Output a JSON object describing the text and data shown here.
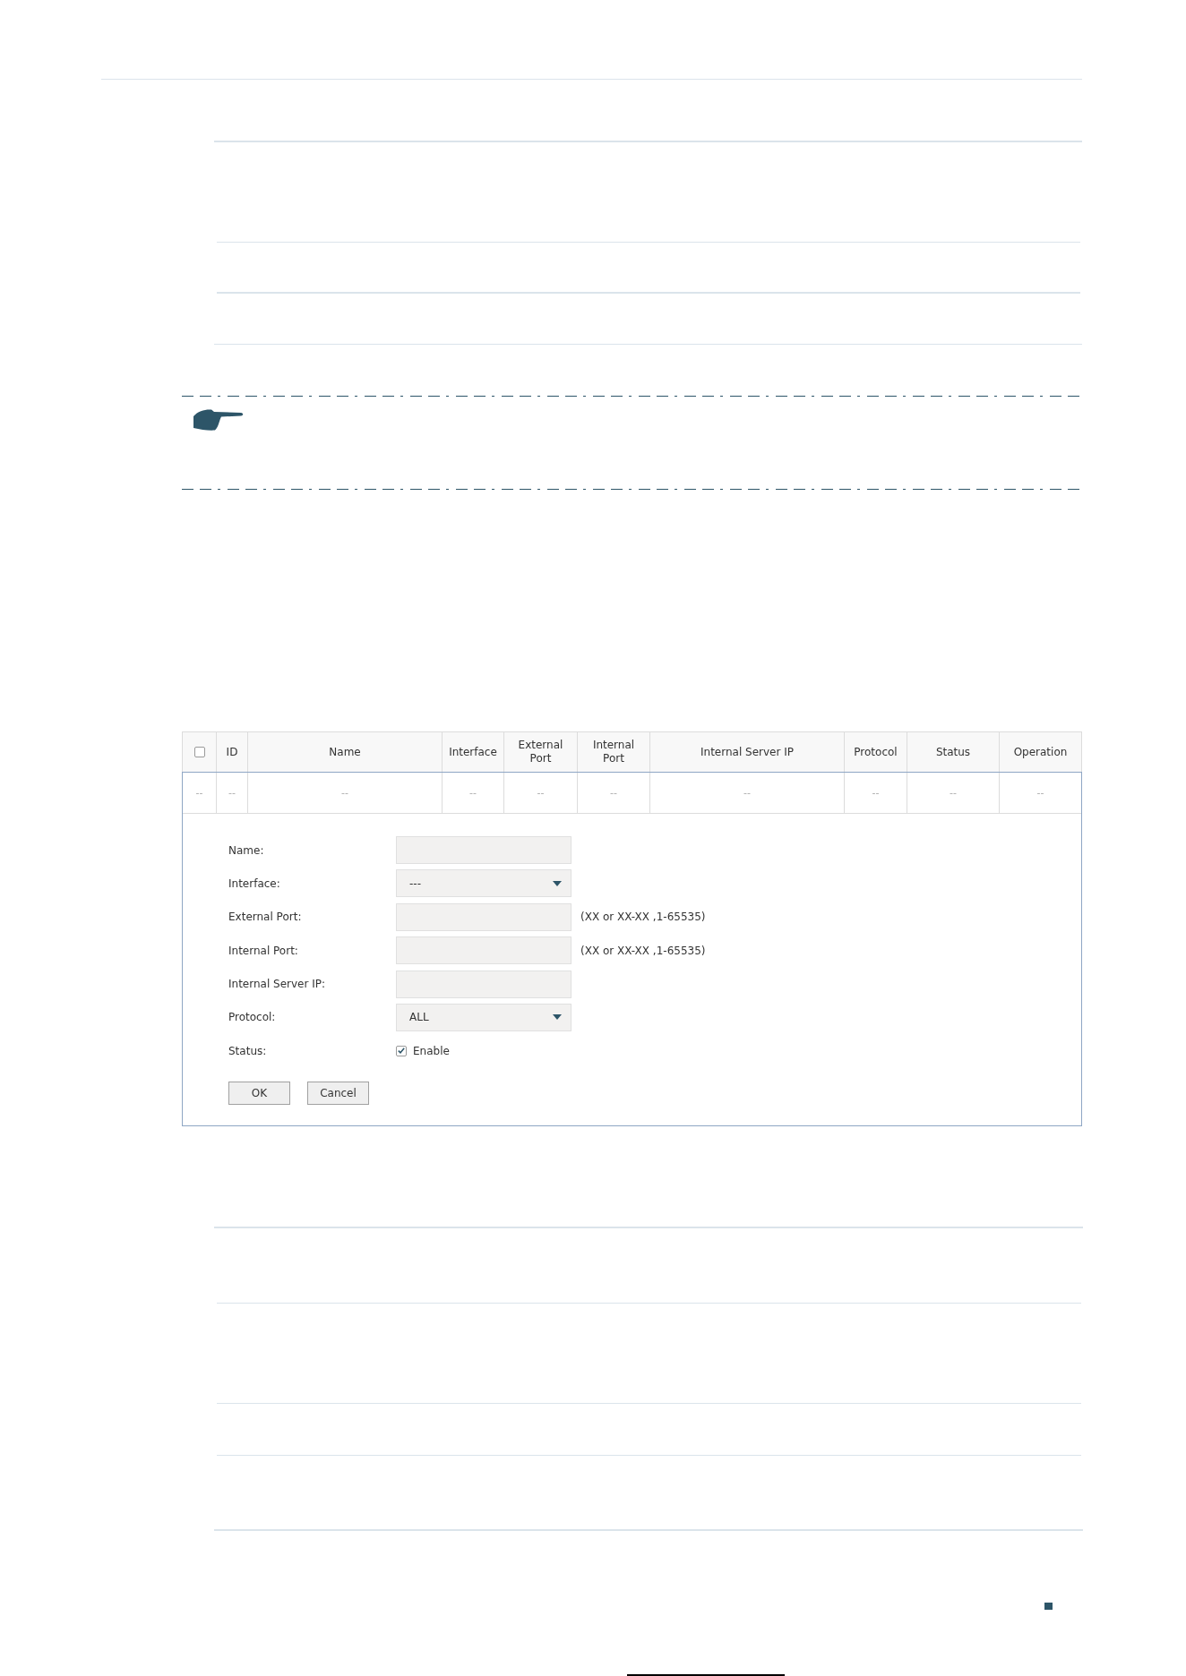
{
  "table": {
    "columns": [
      {
        "kind": "checkbox",
        "checked": false
      },
      {
        "kind": "text",
        "label": "ID"
      },
      {
        "kind": "text",
        "label": "Name"
      },
      {
        "kind": "text",
        "label": "Interface"
      },
      {
        "kind": "text",
        "label": "External Port"
      },
      {
        "kind": "text",
        "label": "Internal Port"
      },
      {
        "kind": "text",
        "label": "Internal Server IP"
      },
      {
        "kind": "text",
        "label": "Protocol"
      },
      {
        "kind": "text",
        "label": "Status"
      },
      {
        "kind": "text",
        "label": "Operation"
      }
    ],
    "rows": [
      {
        "cells": [
          "--",
          "--",
          "--",
          "--",
          "--",
          "--",
          "--",
          "--",
          "--",
          "--"
        ]
      }
    ]
  },
  "form": {
    "fields": [
      {
        "kind": "input",
        "label": "Name:"
      },
      {
        "kind": "select",
        "label": "Interface:",
        "value": "---"
      },
      {
        "kind": "input",
        "label": "External Port:",
        "hint": "(XX or XX-XX ,1-65535)"
      },
      {
        "kind": "input",
        "label": "Internal Port:",
        "hint": "(XX or XX-XX ,1-65535)"
      },
      {
        "kind": "input",
        "label": "Internal Server IP:"
      },
      {
        "kind": "select",
        "label": "Protocol:",
        "value": "ALL"
      },
      {
        "kind": "checkbox",
        "label": "Status:",
        "option": "Enable",
        "checked": true
      }
    ],
    "buttons": [
      "OK",
      "Cancel"
    ]
  }
}
